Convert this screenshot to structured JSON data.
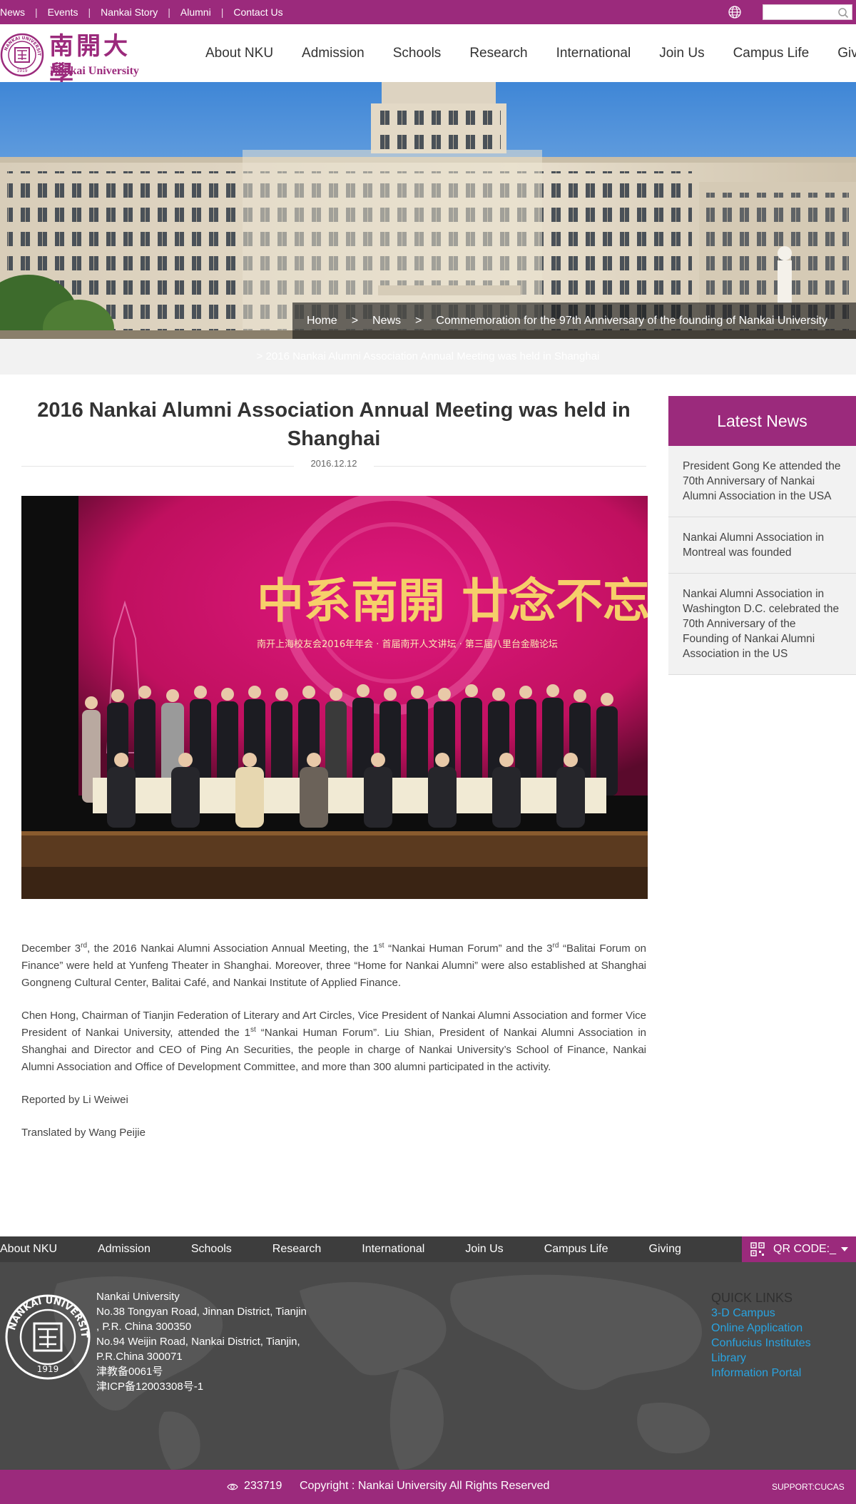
{
  "topbar": {
    "links": [
      "News",
      "Events",
      "Nankai Story",
      "Alumni",
      "Contact Us"
    ],
    "search_placeholder": ""
  },
  "header": {
    "logo_cn": "南開大學",
    "logo_en": "Nankai University",
    "seal_text": "NANKAI UNIVERSITY",
    "seal_year": "1919",
    "nav": [
      "About NKU",
      "Admission",
      "Schools",
      "Research",
      "International",
      "Join Us",
      "Campus Life",
      "Giving"
    ]
  },
  "breadcrumb": {
    "items": [
      "Home",
      "News",
      "Commemoration for the 97th Anniversary of the founding of Nankai University"
    ],
    "separator": ">",
    "current": "> 2016 Nankai Alumni Association Annual Meeting was held in Shanghai"
  },
  "article": {
    "title": "2016 Nankai Alumni Association Annual Meeting was held in Shanghai",
    "date": "2016.12.12",
    "photo_banner_cn": "中系南開 廿念不忘",
    "photo_sub_cn": "南开上海校友会2016年年会 · 首届南开人文讲坛 · 第三届八里台金融论坛",
    "para1": {
      "a": "December 3",
      "a_sup": "rd",
      "b": ", the 2016 Nankai Alumni Association Annual Meeting, the 1",
      "b_sup": "st",
      "c": " “Nankai Human Forum” and the 3",
      "c_sup": "rd",
      "d": " “Balitai Forum on Finance” were held at Yunfeng Theater in Shanghai. Moreover, three “Home for Nankai Alumni” were also established at Shanghai Gongneng Cultural Center, Balitai Café, and Nankai Institute of Applied Finance."
    },
    "para2": {
      "a": "Chen Hong, Chairman of Tianjin Federation of Literary and Art Circles, Vice President of Nankai Alumni Association and former Vice President of Nankai University, attended the 1",
      "a_sup": "st",
      "b": " “Nankai Human Forum”. Liu Shian, President of Nankai Alumni Association in Shanghai and Director and CEO of Ping An Securities, the people in charge of Nankai University’s School of Finance, Nankai Alumni Association and Office of Development Committee, and more than 300 alumni participated in the activity."
    },
    "reporter": "Reported by Li Weiwei",
    "translator": "Translated by Wang Peijie"
  },
  "sidebar": {
    "heading": "Latest News",
    "items": [
      "President Gong Ke attended the 70th Anniversary of Nankai Alumni Association in the USA",
      "Nankai Alumni Association in Montreal was founded",
      "Nankai Alumni Association in Washington D.C. celebrated the 70th Anniversary of the Founding of Nankai Alumni Association in the US"
    ]
  },
  "footer": {
    "nav": [
      "About NKU",
      "Admission",
      "Schools",
      "Research",
      "International",
      "Join Us",
      "Campus Life",
      "Giving"
    ],
    "qr_label": "QR CODE:_",
    "address_lines": [
      "Nankai University",
      "No.38 Tongyan Road, Jinnan District, Tianjin",
      ", P.R. China 300350",
      "No.94 Weijin Road,  Nankai District, Tianjin,",
      "P.R.China  300071",
      "津教备0061号",
      "津ICP备12003308号-1"
    ],
    "quicklinks_title": "QUICK LINKS",
    "quicklinks": [
      "3-D Campus",
      "Online Application",
      "Confucius Institutes",
      "Library",
      "Information Portal"
    ],
    "visit_count": "233719",
    "copyright": "Copyright : Nankai University All Rights Reserved",
    "support": "SUPPORT:CUCAS"
  },
  "colors": {
    "brand_purple": "#9b2a7c",
    "footer_dark": "#4a4a4a",
    "link_blue": "#29a3e0"
  }
}
